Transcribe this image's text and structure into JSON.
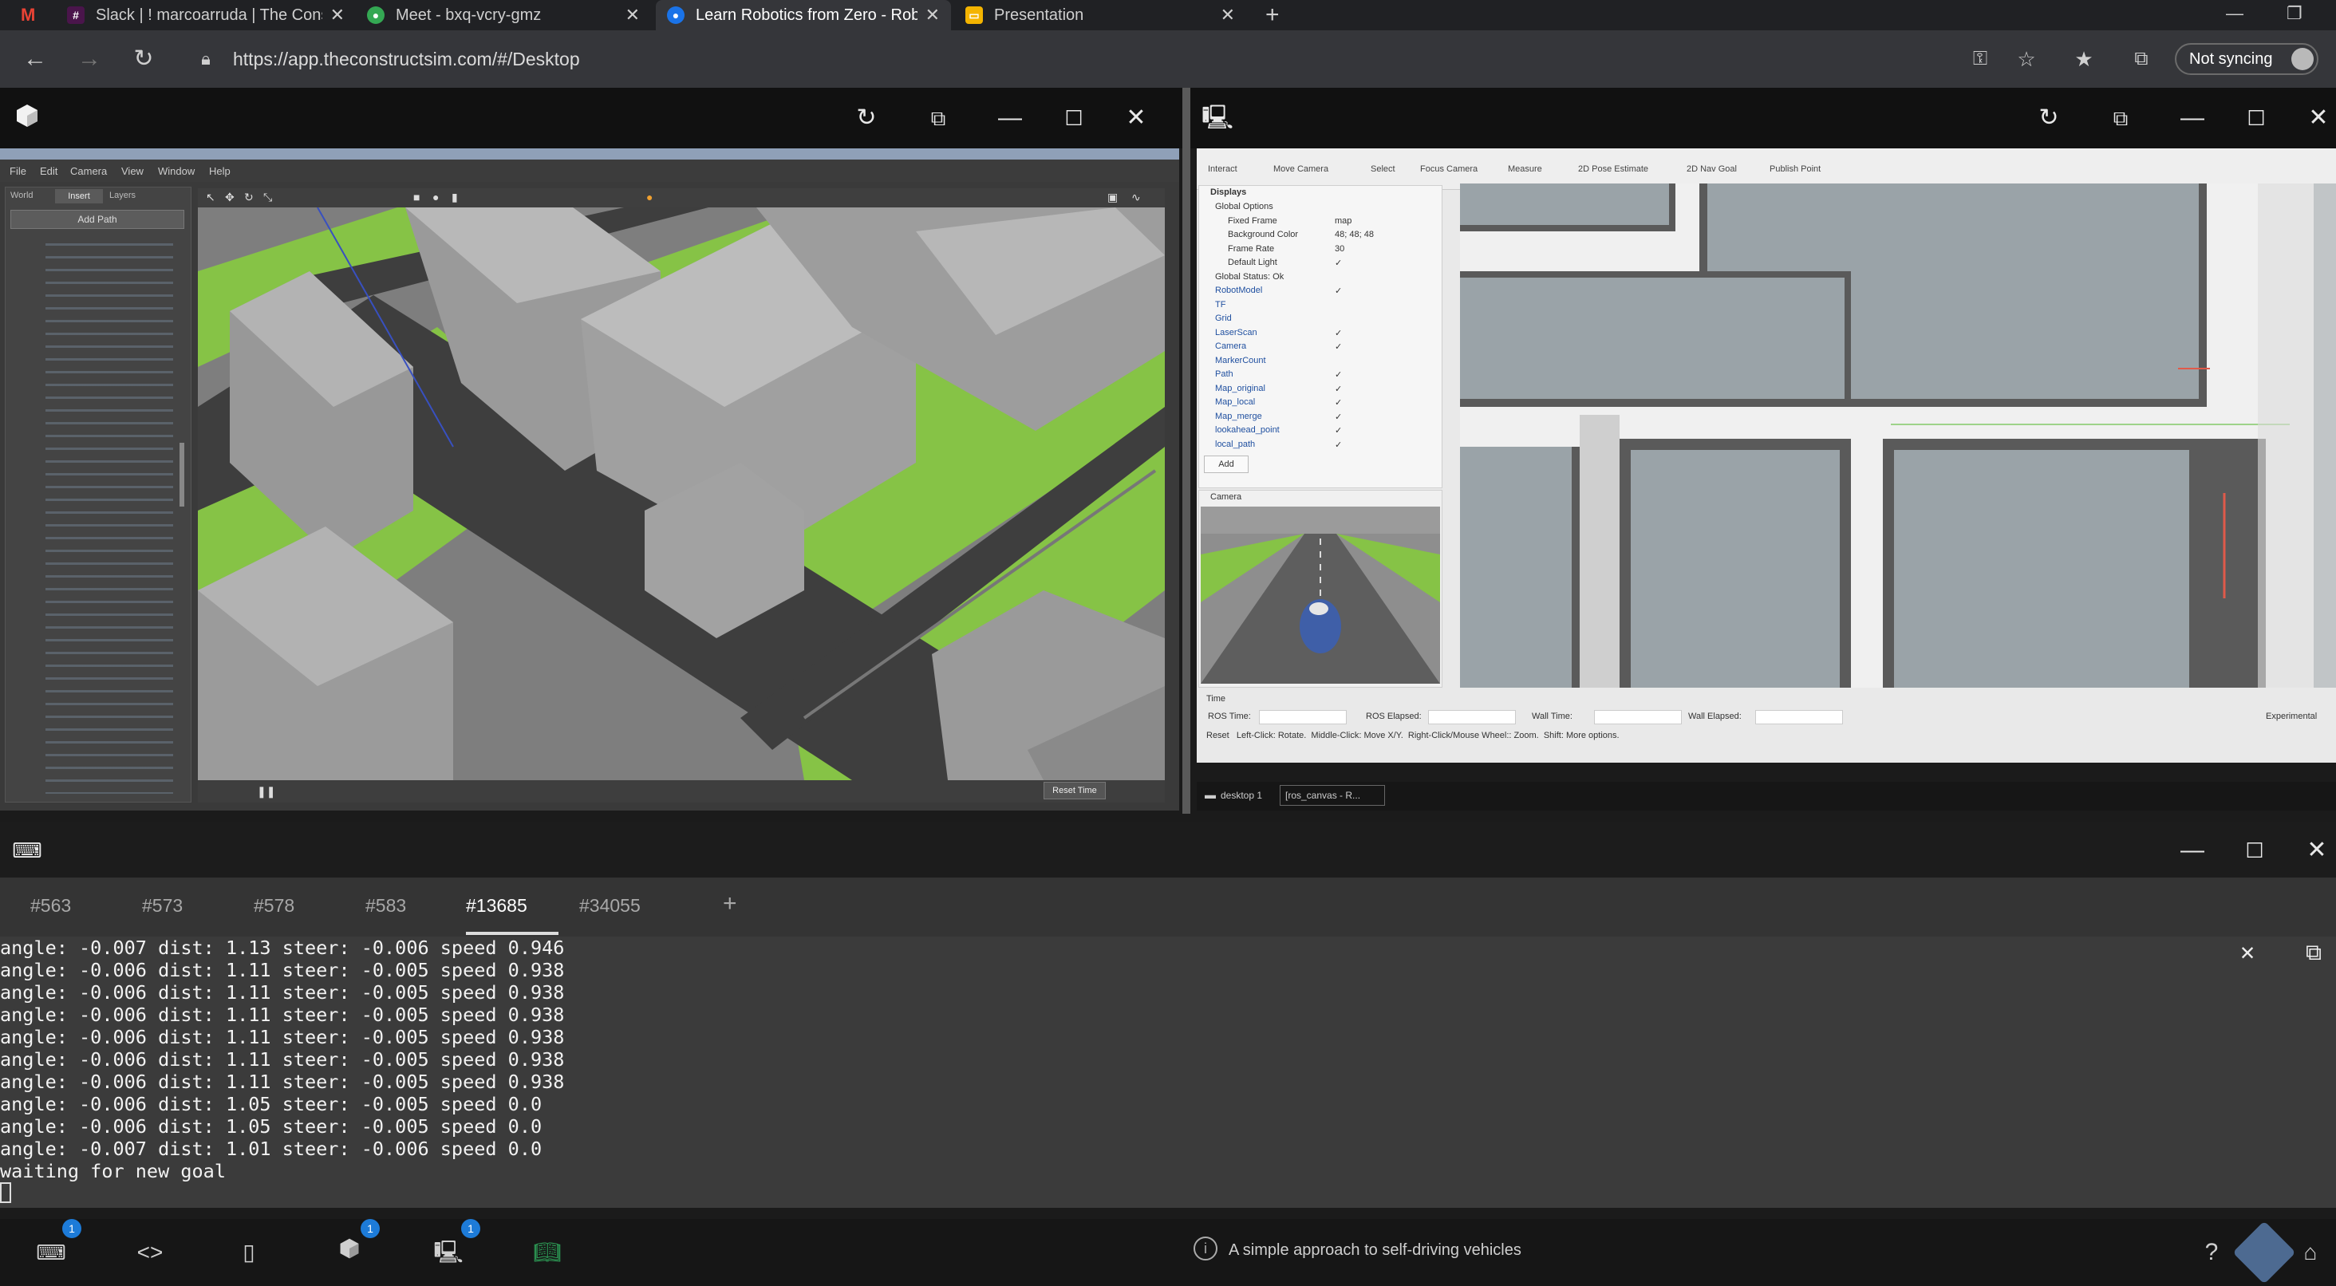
{
  "browser": {
    "tabs": [
      {
        "title": "Slack | ! marcoarruda | The Const",
        "icon": "slack-icon"
      },
      {
        "title": "Meet - bxq-vcry-gmz",
        "icon": "meet-icon"
      },
      {
        "title": "Learn Robotics from Zero - Robo",
        "icon": "robotics-icon"
      },
      {
        "title": "Presentation",
        "icon": "presentation-icon"
      }
    ],
    "url": "https://app.theconstructsim.com/#/Desktop",
    "sync_label": "Not syncing"
  },
  "gazebo": {
    "menu": [
      "File",
      "Edit",
      "Camera",
      "View",
      "Window",
      "Help"
    ],
    "side_tabs": [
      "World",
      "Insert",
      "Layers"
    ],
    "add_path": "Add Path",
    "bottom_button": "Reset Time"
  },
  "rviz": {
    "toolbar": [
      "Interact",
      "Move Camera",
      "Select",
      "Focus Camera",
      "Measure",
      "2D Pose Estimate",
      "2D Nav Goal",
      "Publish Point"
    ],
    "displays_title": "Displays",
    "displays": [
      {
        "name": "Global Options",
        "value": ""
      },
      {
        "name": "Fixed Frame",
        "value": "map"
      },
      {
        "name": "Background Color",
        "value": "48; 48; 48"
      },
      {
        "name": "Frame Rate",
        "value": "30"
      },
      {
        "name": "Default Light",
        "value": "✓"
      },
      {
        "name": "Global Status: Ok",
        "value": ""
      },
      {
        "name": "RobotModel",
        "value": "✓"
      },
      {
        "name": "TF",
        "value": ""
      },
      {
        "name": "Grid",
        "value": ""
      },
      {
        "name": "LaserScan",
        "value": "✓"
      },
      {
        "name": "Camera",
        "value": "✓"
      },
      {
        "name": "MarkerCount",
        "value": ""
      },
      {
        "name": "Path",
        "value": "✓"
      },
      {
        "name": "Map_original",
        "value": "✓"
      },
      {
        "name": "Map_local",
        "value": "✓"
      },
      {
        "name": "Map_merge",
        "value": "✓"
      },
      {
        "name": "lookahead_point",
        "value": "✓"
      },
      {
        "name": "local_path",
        "value": "✓"
      }
    ],
    "add_button": "Add",
    "camera_title": "Camera",
    "time_title": "Time",
    "time_fields": [
      {
        "label": "ROS Time:",
        "value": ""
      },
      {
        "label": "ROS Elapsed:",
        "value": ""
      },
      {
        "label": "Wall Time:",
        "value": ""
      },
      {
        "label": "Wall Elapsed:",
        "value": ""
      }
    ],
    "hint": "Reset   Left-Click: Rotate.  Middle-Click: Move X/Y.  Right-Click/Mouse Wheel:: Zoom.  Shift: More options.",
    "experimental": "Experimental"
  },
  "desktop_bar": {
    "desktop_label": "desktop 1",
    "task_label": "[ros_canvas - R..."
  },
  "terminal": {
    "tabs": [
      "#563",
      "#573",
      "#578",
      "#583",
      "#13685",
      "#34055"
    ],
    "add_tab": "+",
    "lines": [
      "angle: -0.007 dist: 1.13 steer: -0.006 speed 0.946",
      "angle: -0.006 dist: 1.11 steer: -0.005 speed 0.938",
      "angle: -0.006 dist: 1.11 steer: -0.005 speed 0.938",
      "angle: -0.006 dist: 1.11 steer: -0.005 speed 0.938",
      "angle: -0.006 dist: 1.11 steer: -0.005 speed 0.938",
      "angle: -0.006 dist: 1.11 steer: -0.005 speed 0.938",
      "angle: -0.006 dist: 1.11 steer: -0.005 speed 0.938",
      "angle: -0.006 dist: 1.05 steer: -0.005 speed 0.0",
      "angle: -0.006 dist: 1.05 steer: -0.005 speed 0.0",
      "angle: -0.007 dist: 1.01 steer: -0.006 speed 0.0",
      "waiting for new goal"
    ]
  },
  "bottom": {
    "status": "A simple approach to self-driving vehicles",
    "badges": [
      "1",
      "1",
      "1"
    ]
  }
}
